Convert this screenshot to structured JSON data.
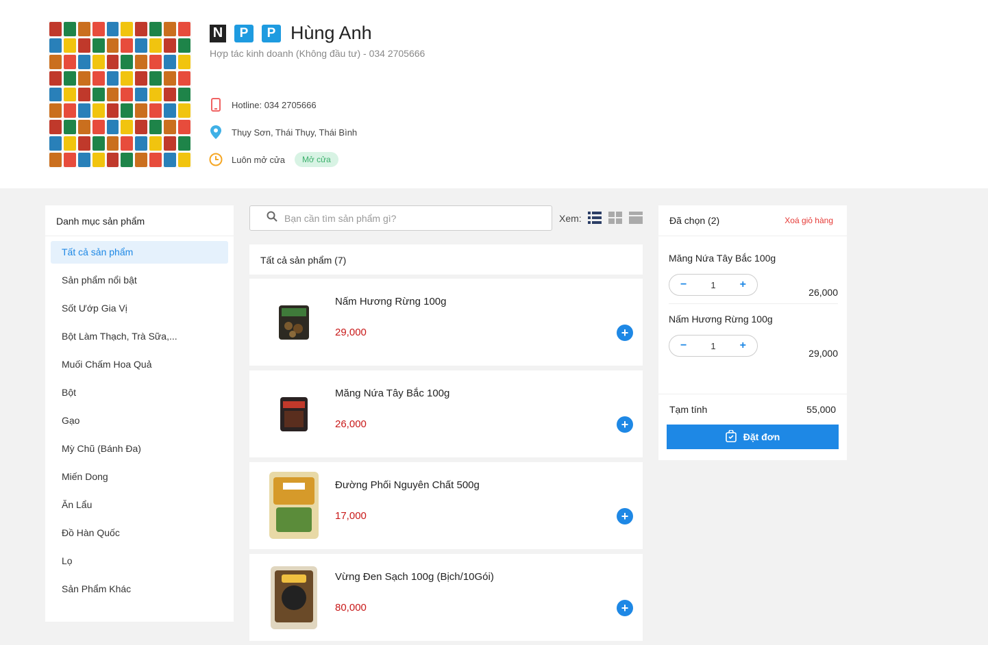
{
  "store": {
    "badges": [
      "N",
      "P",
      "P"
    ],
    "name": "Hùng Anh",
    "subtitle": "Hợp tác kinh doanh (Không đầu tư) - 034 2705666",
    "hotline": "Hotline: 034 2705666",
    "address": "Thụy Sơn, Thái Thụy, Thái Bình",
    "hours": "Luôn mở cửa",
    "open_status": "Mở cửa"
  },
  "sidebar": {
    "title": "Danh mục sản phẩm",
    "items": [
      {
        "label": "Tất cả sản phẩm",
        "active": true
      },
      {
        "label": "Sản phẩm nổi bật"
      },
      {
        "label": "Sốt Ướp Gia Vị"
      },
      {
        "label": "Bột Làm Thạch, Trà Sữa,..."
      },
      {
        "label": "Muối Chấm Hoa Quả"
      },
      {
        "label": "Bột"
      },
      {
        "label": "Gạo"
      },
      {
        "label": "Mỳ Chũ (Bánh Đa)"
      },
      {
        "label": "Miến Dong"
      },
      {
        "label": "Ăn Lẩu"
      },
      {
        "label": "Đồ Hàn Quốc"
      },
      {
        "label": "Lọ"
      },
      {
        "label": "Sản Phẩm Khác"
      }
    ]
  },
  "search": {
    "placeholder": "Bạn cần tìm sản phẩm gì?"
  },
  "view": {
    "label": "Xem:"
  },
  "list": {
    "header": "Tất cả sản phẩm (7)",
    "products": [
      {
        "name": "Nấm Hương Rừng 100g",
        "price": "29,000"
      },
      {
        "name": "Măng Nứa Tây Bắc 100g",
        "price": "26,000"
      },
      {
        "name": "Đường Phối Nguyên Chất 500g",
        "price": "17,000"
      },
      {
        "name": "Vừng Đen Sạch 100g (Bịch/10Gói)",
        "price": "80,000"
      }
    ],
    "add_symbol": "+"
  },
  "cart": {
    "title": "Đã chọn (2)",
    "clear_label": "Xoá giỏ hàng",
    "items": [
      {
        "name": "Măng Nứa Tây Bắc 100g",
        "qty": "1",
        "price": "26,000"
      },
      {
        "name": "Nấm Hương Rừng 100g",
        "qty": "1",
        "price": "29,000"
      }
    ],
    "minus": "−",
    "plus": "+",
    "subtotal_label": "Tạm tính",
    "subtotal_value": "55,000",
    "order_label": "Đặt đơn"
  },
  "colors": {
    "accent": "#1e88e5",
    "price": "#c81818",
    "open_badge_bg": "#d8f3e4",
    "open_badge_text": "#3bb06b",
    "clear": "#e53935"
  }
}
